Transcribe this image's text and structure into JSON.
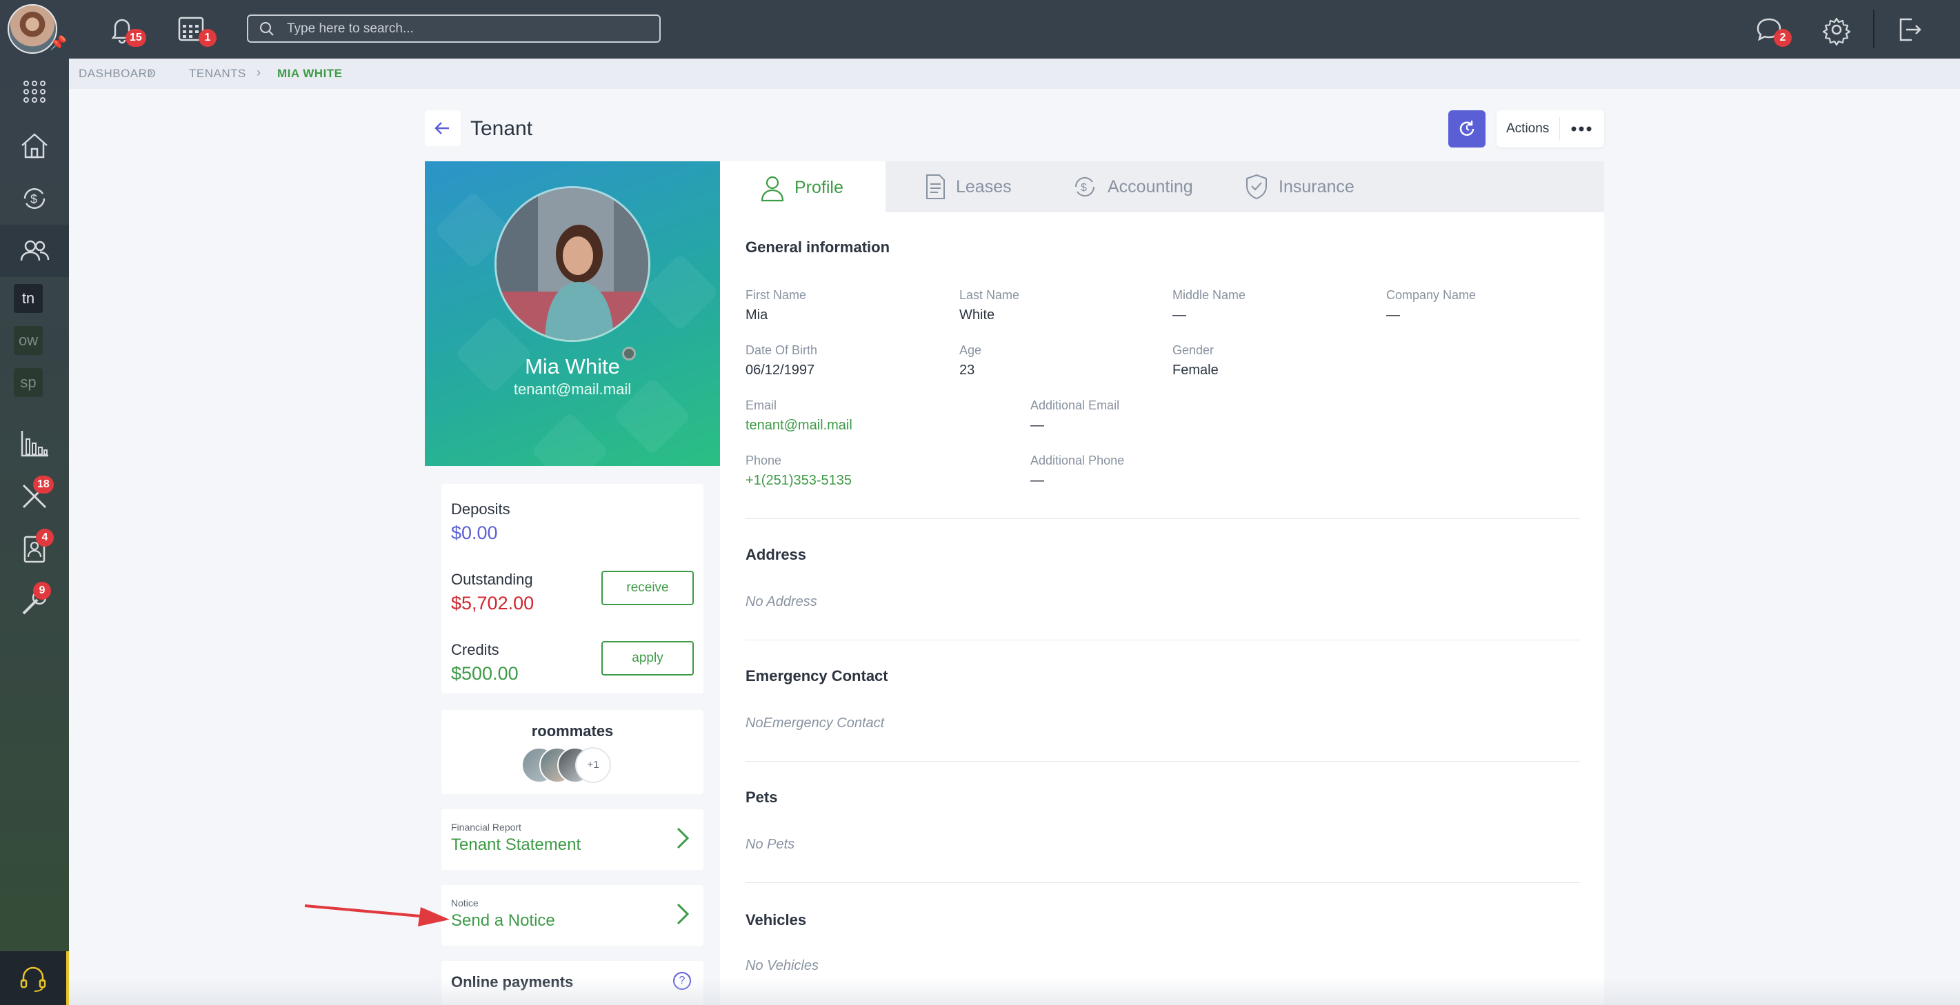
{
  "topbar": {
    "notifications_count": "15",
    "calendar_count": "1",
    "search_placeholder": "Type here to search...",
    "messages_count": "2"
  },
  "sidebar": {
    "items": [
      {
        "icon": "apps-grid-icon"
      },
      {
        "icon": "house-icon"
      },
      {
        "icon": "money-cycle-icon"
      },
      {
        "icon": "people-icon",
        "active": true
      },
      {
        "tag": "tn"
      },
      {
        "tag": "ow"
      },
      {
        "tag": "sp"
      },
      {
        "icon": "bar-chart-icon"
      },
      {
        "icon": "tools-icon",
        "badge": "18"
      },
      {
        "icon": "contact-book-icon",
        "badge": "4"
      },
      {
        "icon": "wrench-icon",
        "badge": "9"
      },
      {
        "icon": "headset-icon"
      }
    ]
  },
  "breadcrumb": {
    "items": [
      "DASHBOARD",
      "TENANTS",
      "MIA WHITE"
    ]
  },
  "page": {
    "title": "Tenant",
    "actions_label": "Actions"
  },
  "profile": {
    "name": "Mia White",
    "email": "tenant@mail.mail"
  },
  "finance": {
    "deposits_label": "Deposits",
    "deposits_value": "$0.00",
    "outstanding_label": "Outstanding",
    "outstanding_value": "$5,702.00",
    "receive_label": "receive",
    "credits_label": "Credits",
    "credits_value": "$500.00",
    "apply_label": "apply"
  },
  "roommates": {
    "title": "roommates",
    "more": "+1"
  },
  "links": {
    "statement_small": "Financial Report",
    "statement_big": "Tenant Statement",
    "notice_small": "Notice",
    "notice_big": "Send a Notice",
    "online_payments": "Online payments",
    "help": "?"
  },
  "tabs": [
    "Profile",
    "Leases",
    "Accounting",
    "Insurance"
  ],
  "general": {
    "title": "General information",
    "first_name_label": "First Name",
    "first_name": "Mia",
    "last_name_label": "Last Name",
    "last_name": "White",
    "middle_name_label": "Middle Name",
    "middle_name": "—",
    "company_label": "Company Name",
    "company": "—",
    "dob_label": "Date Of Birth",
    "dob": "06/12/1997",
    "age_label": "Age",
    "age": "23",
    "gender_label": "Gender",
    "gender": "Female",
    "email_label": "Email",
    "email": "tenant@mail.mail",
    "add_email_label": "Additional Email",
    "add_email": "—",
    "phone_label": "Phone",
    "phone": "+1(251)353-5135",
    "add_phone_label": "Additional Phone",
    "add_phone": "—"
  },
  "sections": {
    "address_title": "Address",
    "address_empty": "No Address",
    "emergency_title": "Emergency Contact",
    "emergency_empty": "NoEmergency Contact",
    "pets_title": "Pets",
    "pets_empty": "No Pets",
    "vehicles_title": "Vehicles",
    "vehicles_empty": "No Vehicles"
  },
  "colors": {
    "accent_green": "#3d9a46",
    "accent_blue": "#5b5fd6",
    "danger_red": "#d0252d",
    "badge_red": "#e0393e",
    "topbar": "#37414b"
  }
}
